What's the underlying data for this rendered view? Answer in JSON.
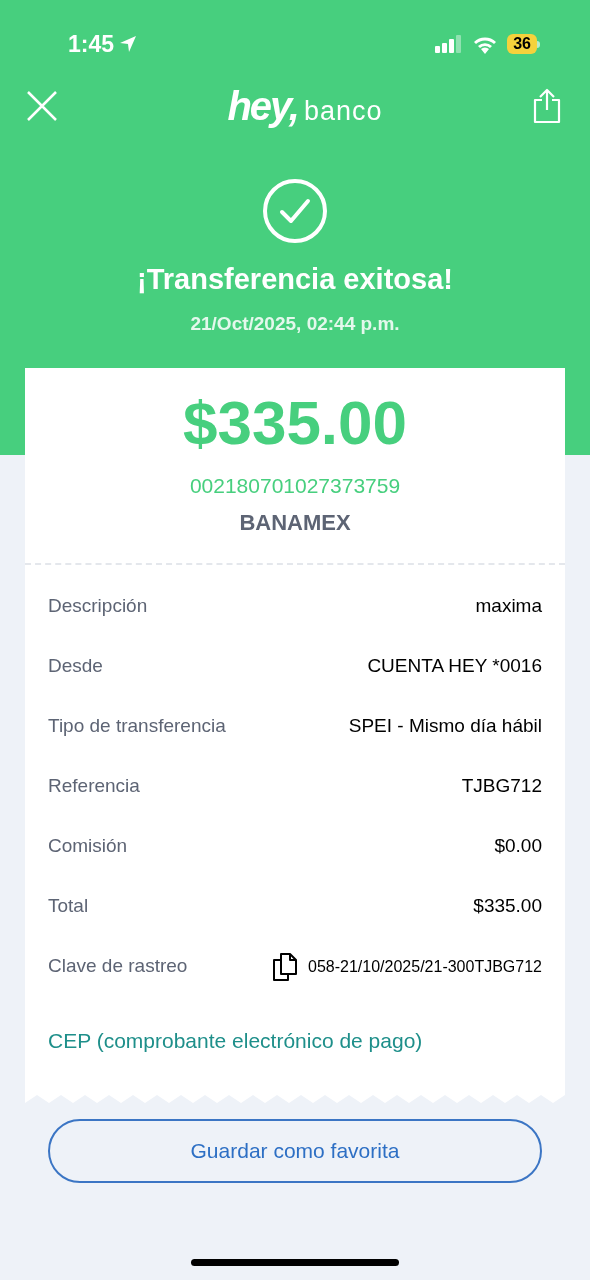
{
  "status_bar": {
    "time": "1:45",
    "battery": "36"
  },
  "header": {
    "logo_main": "hey,",
    "logo_sub": "banco",
    "title": "¡Transferencia exitosa!",
    "date": "21/Oct/2025, 02:44 p.m."
  },
  "receipt": {
    "amount": "$335.00",
    "account": "002180701027373759",
    "bank": "BANAMEX",
    "rows": [
      {
        "kind": "plain",
        "label": "Descripción",
        "value": "maxima"
      },
      {
        "kind": "plain",
        "label": "Desde",
        "value": "CUENTA HEY *0016"
      },
      {
        "kind": "plain",
        "label": "Tipo de transferencia",
        "value": "SPEI - Mismo día hábil"
      },
      {
        "kind": "plain",
        "label": "Referencia",
        "value": "TJBG712"
      },
      {
        "kind": "plain",
        "label": "Comisión",
        "value": "$0.00"
      },
      {
        "kind": "plain",
        "label": "Total",
        "value": "$335.00"
      },
      {
        "kind": "copy",
        "label": "Clave de rastreo",
        "value": "058-21/10/2025/21-300TJBG712"
      }
    ],
    "link": "CEP (comprobante electrónico de pago)"
  },
  "button": "Guardar como favorita"
}
